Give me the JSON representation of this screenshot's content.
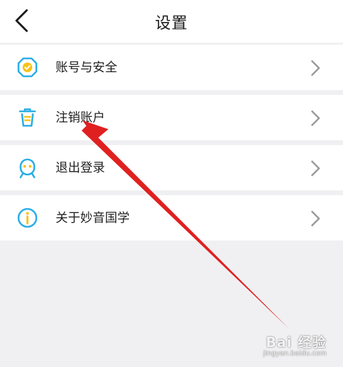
{
  "header": {
    "title": "设置",
    "back_icon": "chevron-left-icon"
  },
  "menu": [
    {
      "label": "账号与安全",
      "icon": "shield-check-icon"
    },
    {
      "label": "注销账户",
      "icon": "trash-icon"
    },
    {
      "label": "退出登录",
      "icon": "logout-face-icon"
    },
    {
      "label": "关于妙音国学",
      "icon": "info-icon"
    }
  ],
  "accent_color": "#2aaee6",
  "annotation": {
    "type": "arrow",
    "color": "#e02020",
    "icon": "red-arrow-annotation"
  },
  "watermark": {
    "main": "Bai 经验",
    "sub": "jingyan.baidu.com"
  }
}
